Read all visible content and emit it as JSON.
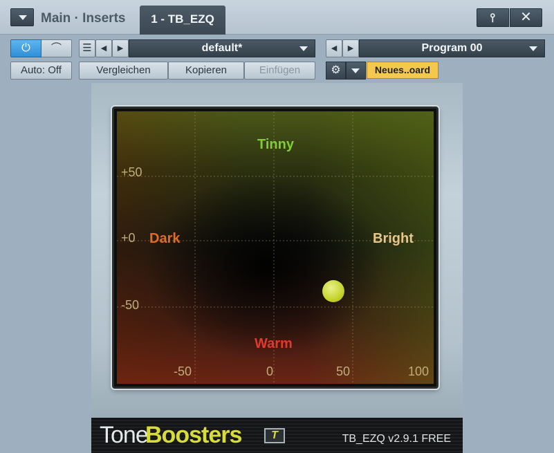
{
  "window": {
    "title": "Main · Inserts",
    "active_tab": "1 - TB_EZQ",
    "pin_glyph": "⫯",
    "close_glyph": "✕"
  },
  "toolbar": {
    "power_glyph": "⏻",
    "bypass_glyph": "⌒",
    "list_glyph": "☰",
    "prev_glyph": "◀",
    "next_glyph": "▶",
    "preset_name": "default*",
    "program_name": "Program 00",
    "auto_label": "Auto: Off",
    "compare_label": "Vergleichen",
    "copy_label": "Kopieren",
    "paste_label": "Einfügen",
    "gear_glyph": "⚙",
    "sticky_note": "Neues..oard"
  },
  "plugin": {
    "zones": {
      "tinny": "Tinny",
      "dark": "Dark",
      "bright": "Bright",
      "warm": "Warm"
    },
    "y_axis_labels": [
      "+50",
      "+0",
      "-50"
    ],
    "x_axis_labels": [
      "-50",
      "0",
      "50",
      "100"
    ],
    "control_point": {
      "x": 45,
      "y": -38
    },
    "brand_tone": "Tone",
    "brand_boosters": "Boosters",
    "brand_logo": "T",
    "version": "TB_EZQ v2.9.1 FREE"
  },
  "colors": {
    "accent_blue": "#2f8fd6",
    "sticky_yellow": "#f4c84c",
    "dot_yellow": "#c6d42c",
    "tinny_green": "#7fce35",
    "dark_orange": "#e06a28",
    "bright_tan": "#e8c58a",
    "warm_red": "#e03a2c"
  }
}
